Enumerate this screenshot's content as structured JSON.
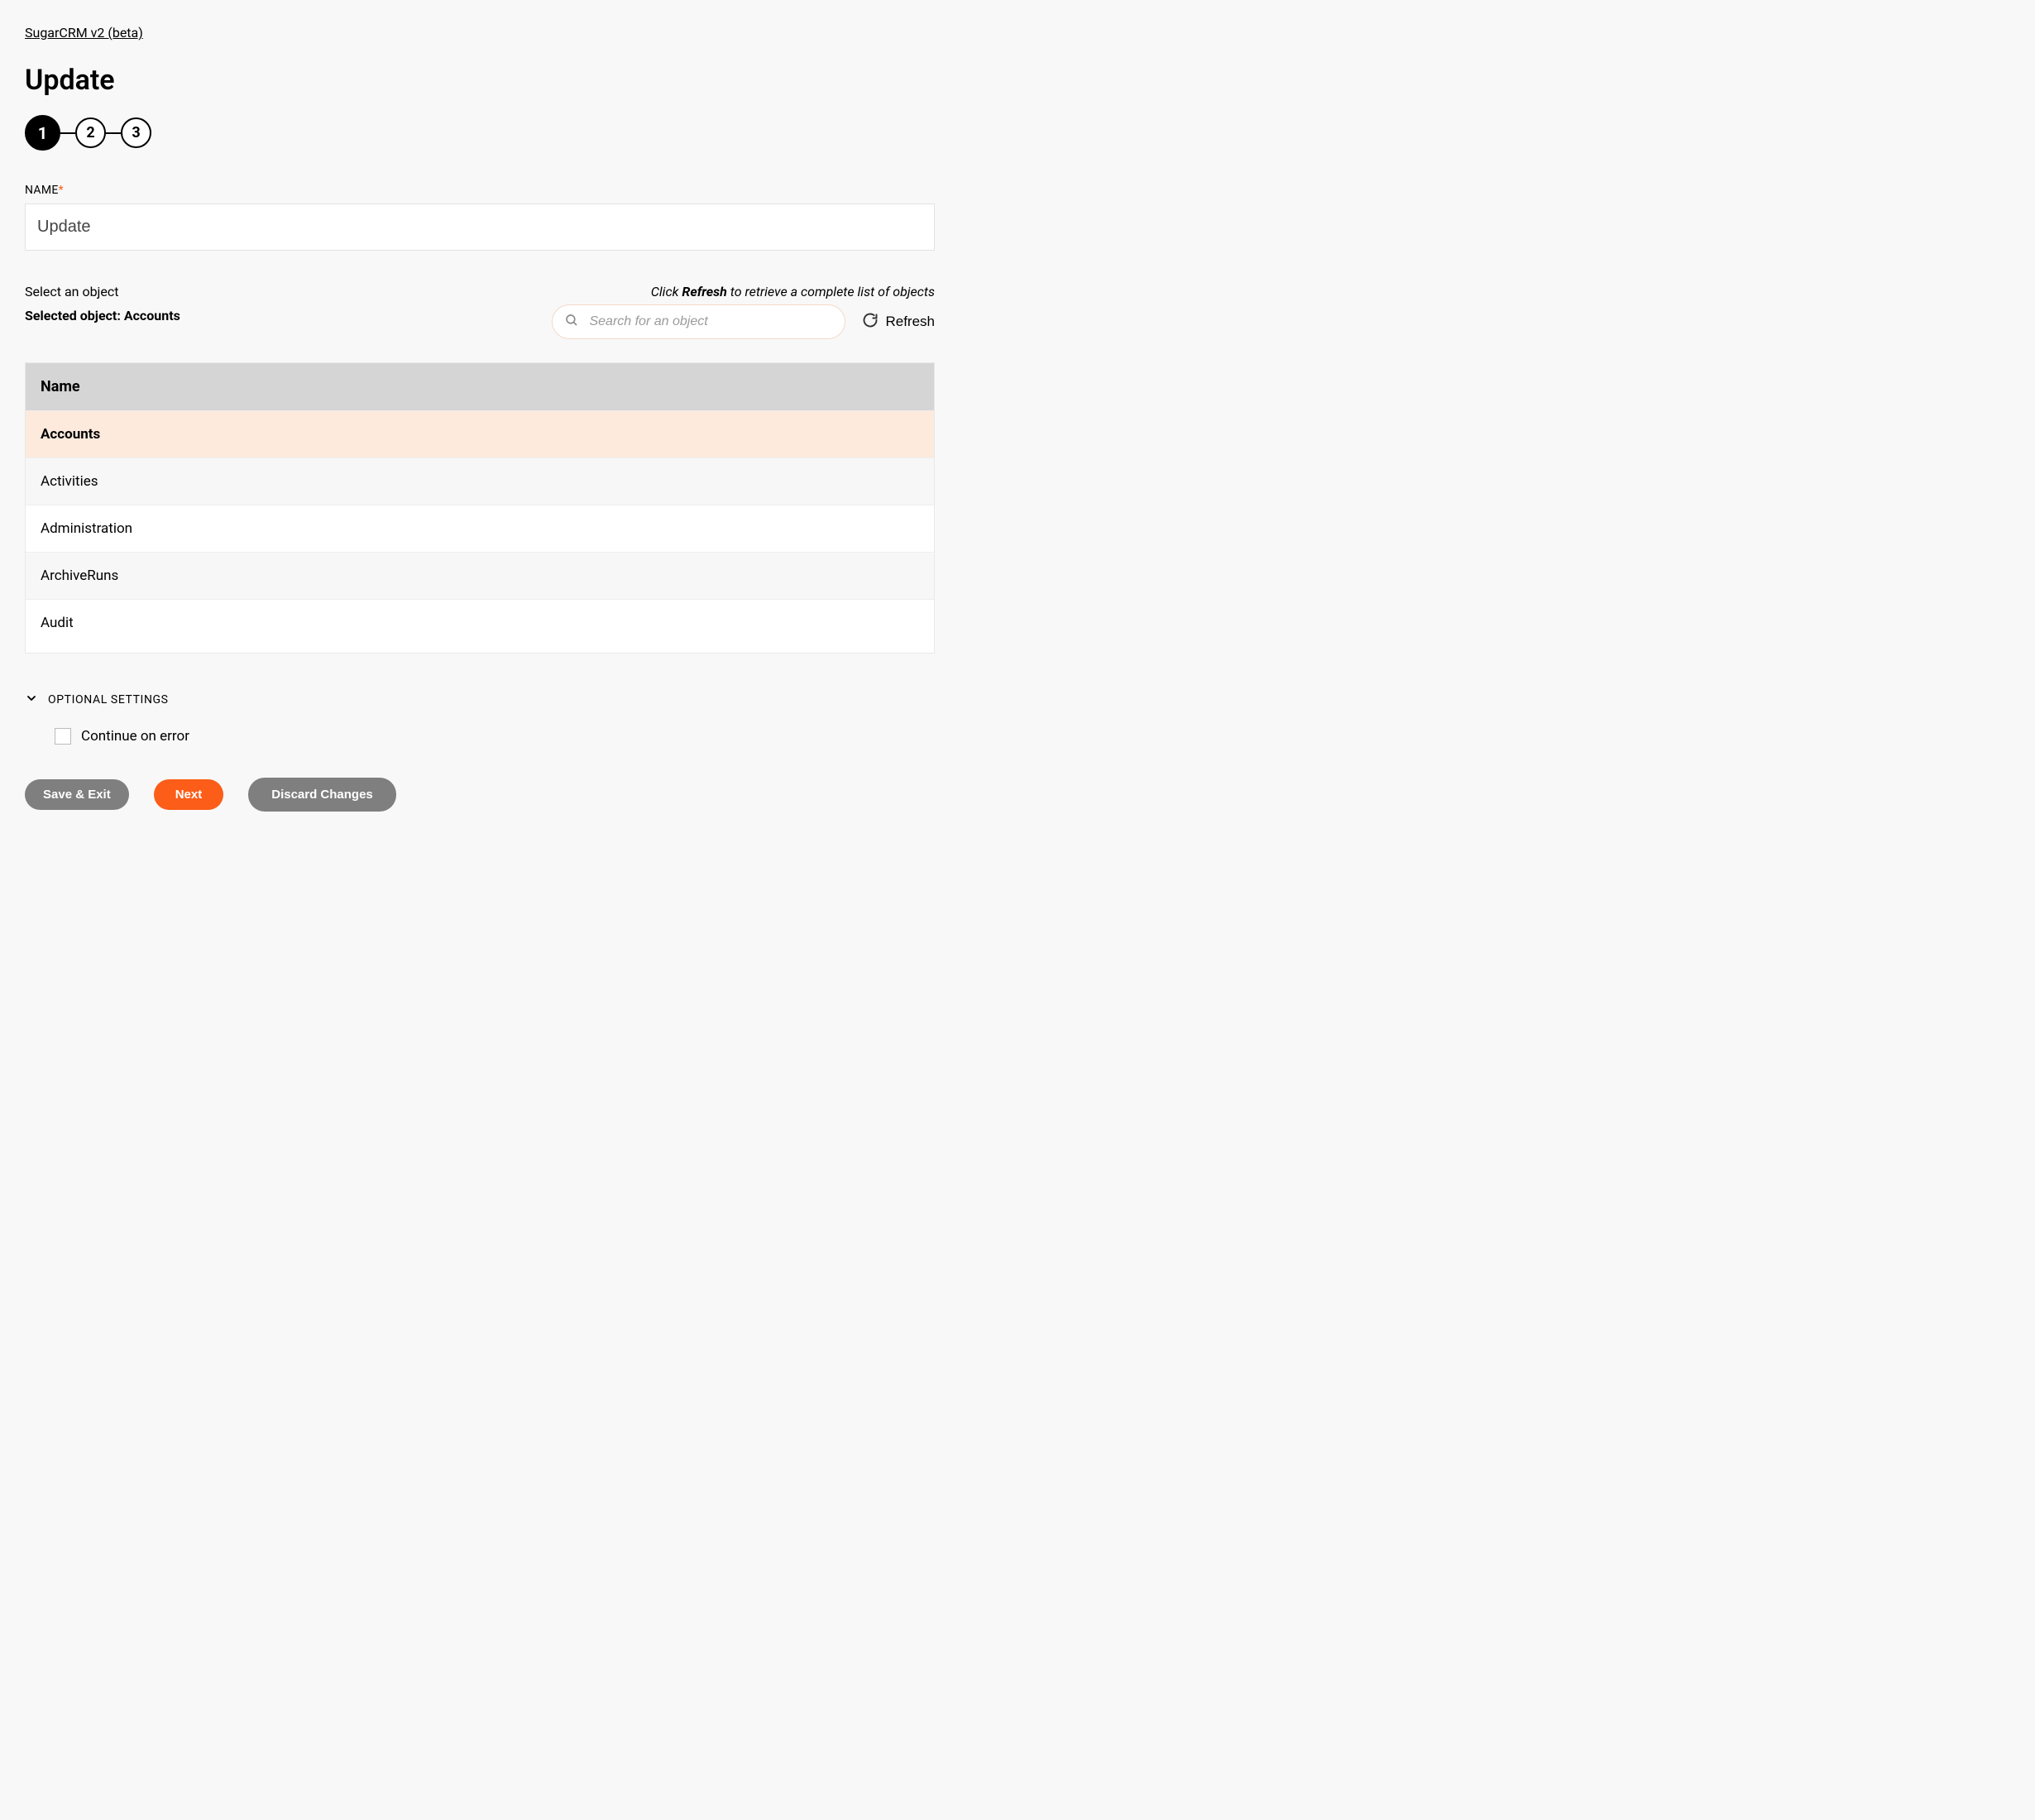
{
  "breadcrumb": {
    "label": "SugarCRM v2 (beta)"
  },
  "page": {
    "title": "Update"
  },
  "stepper": {
    "steps": [
      "1",
      "2",
      "3"
    ],
    "active": 0
  },
  "nameField": {
    "label": "NAME",
    "required": "*",
    "value": "Update"
  },
  "selectSection": {
    "label": "Select an object",
    "selectedPrefix": "Selected object: ",
    "selectedValue": "Accounts",
    "hintPrefix": "Click ",
    "hintBold": "Refresh",
    "hintSuffix": " to retrieve a complete list of objects",
    "searchPlaceholder": "Search for an object",
    "refreshLabel": "Refresh"
  },
  "table": {
    "header": "Name",
    "rows": [
      {
        "label": "Accounts",
        "selected": true
      },
      {
        "label": "Activities",
        "selected": false
      },
      {
        "label": "Administration",
        "selected": false
      },
      {
        "label": "ArchiveRuns",
        "selected": false
      },
      {
        "label": "Audit",
        "selected": false
      }
    ]
  },
  "optional": {
    "label": "OPTIONAL SETTINGS",
    "checkboxLabel": "Continue on error",
    "checkboxChecked": false
  },
  "buttons": {
    "saveExit": "Save & Exit",
    "next": "Next",
    "discard": "Discard Changes"
  }
}
